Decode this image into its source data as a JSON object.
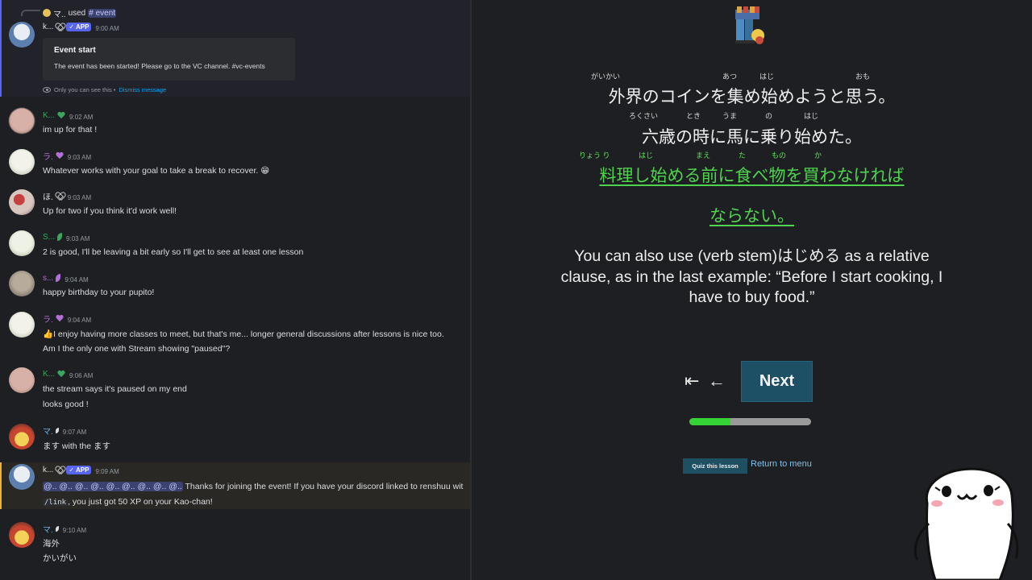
{
  "chat": {
    "top_message": {
      "used_prefix": "マ..",
      "used_text": "used",
      "command": "# event",
      "username": "k...",
      "app_badge": "✓ APP",
      "time": "9:00 AM",
      "embed_title": "Event start",
      "embed_description": "The event has been started! Please go to the VC channel. #vc-events",
      "ephemeral_note": "Only you can see this •",
      "dismiss_link": "Dismiss message"
    },
    "messages": [
      {
        "username": "K...",
        "name_color": "#3ba55d",
        "time": "9:02 AM",
        "lines": [
          "im up for that !"
        ]
      },
      {
        "username": "ラ.",
        "name_color": "#b36fd8",
        "time": "9:03 AM",
        "lines": [
          "Whatever works with your goal to take a break to recover. 😁"
        ]
      },
      {
        "username": "ほ.",
        "name_color": "#dbdee1",
        "time": "9:03 AM",
        "lines": [
          "Up for two if you think it'd work well!"
        ]
      },
      {
        "username": "S...",
        "name_color": "#3ba55d",
        "time": "9:03 AM",
        "lines": [
          "2 is good, I'll be leaving a bit early so I'll get to see at least one lesson"
        ]
      },
      {
        "username": "s...",
        "name_color": "#b36fd8",
        "time": "9:04 AM",
        "lines": [
          "happy birthday to your pupito!"
        ]
      },
      {
        "username": "ラ.",
        "name_color": "#b36fd8",
        "time": "9:04 AM",
        "lines": [
          "👍I enjoy having more classes to meet, but that's me... longer general discussions after lessons is nice too.",
          "Am I the only one with Stream showing \"paused\"?"
        ]
      },
      {
        "username": "K...",
        "name_color": "#3ba55d",
        "time": "9:06 AM",
        "lines": [
          "the stream says it's paused on my end",
          "looks good !"
        ]
      },
      {
        "username": "マ.",
        "name_color": "#6fb3e0",
        "time": "9:07 AM",
        "lines": [
          "ます with the ます"
        ]
      },
      {
        "username": "k...",
        "name_color": "#dbdee1",
        "time": "9:09 AM",
        "app_badge": "✓ APP",
        "mentions": "@.. @.. @.. @.. @.. @.. @.. @.. @..",
        "lines": [
          "Thanks for joining the event! If you have your discord linked to renshuu wit",
          "/link",
          ", you just got 50 XP on your Kao-chan!"
        ]
      },
      {
        "username": "マ.",
        "name_color": "#6fb3e0",
        "time": "9:10 AM",
        "lines": [
          "海外",
          "かいがい"
        ]
      }
    ]
  },
  "lesson": {
    "sentences": [
      {
        "text": "外界のコインを集め始めようと思う。",
        "ruby": [
          "がいかい",
          "あつ",
          "はじ",
          "おも"
        ],
        "highlight": false
      },
      {
        "text": "六歳の時に馬に乗り始めた。",
        "ruby": [
          "ろくさい",
          "とき",
          "うま",
          "の",
          "はじ"
        ],
        "highlight": false
      },
      {
        "text": "料理し始める前に食べ物を買わなければ",
        "ruby": [
          "りょう り",
          "はじ",
          "まえ",
          "た",
          "もの",
          "か"
        ],
        "highlight": true
      },
      {
        "text": "ならない。",
        "ruby": [],
        "highlight": true
      }
    ],
    "explanation": "You can also use (verb stem)はじめる as a relative clause, as in the last example: “Before I start cooking, I have to buy food.”",
    "first_glyph": "⇤",
    "prev_glyph": "←",
    "next_label": "Next",
    "progress": 0.34,
    "quiz_label": "Quiz this lesson",
    "return_label": "Return to menu"
  },
  "colors": {
    "accent_green": "#4ed44e",
    "next_button": "#1d5065",
    "link": "#7dc3ef"
  }
}
